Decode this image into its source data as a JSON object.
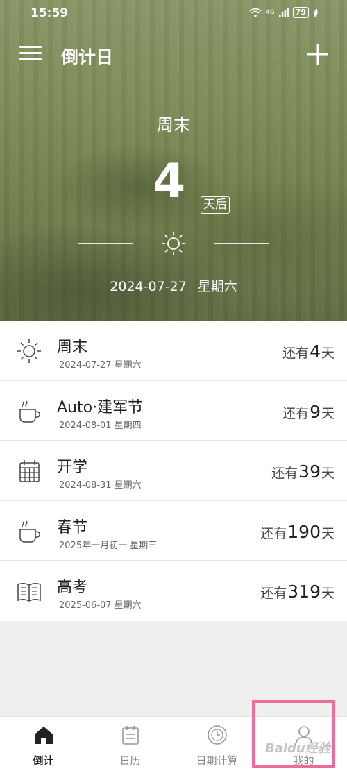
{
  "status": {
    "time": "15:59",
    "network": "4G",
    "battery": "79"
  },
  "header": {
    "title": "倒计日"
  },
  "hero": {
    "name": "周末",
    "count": "4",
    "unit": "天后",
    "date": "2024-07-27 星期六",
    "icon": "sun-icon"
  },
  "events": [
    {
      "name": "周末",
      "date": "2024-07-27 星期六",
      "prefix": "还有",
      "days": "4",
      "suffix": "天",
      "icon": "sun-icon"
    },
    {
      "name": "Auto·建军节",
      "date": "2024-08-01 星期四",
      "prefix": "还有",
      "days": "9",
      "suffix": "天",
      "icon": "coffee-cup-icon"
    },
    {
      "name": "开学",
      "date": "2024-08-31 星期六",
      "prefix": "还有",
      "days": "39",
      "suffix": "天",
      "icon": "calendar-icon"
    },
    {
      "name": "春节",
      "date": "2025年一月初一 星期三",
      "prefix": "还有",
      "days": "190",
      "suffix": "天",
      "icon": "coffee-cup-icon"
    },
    {
      "name": "高考",
      "date": "2025-06-07 星期六",
      "prefix": "还有",
      "days": "319",
      "suffix": "天",
      "icon": "book-icon"
    }
  ],
  "tabs": [
    {
      "label": "倒计",
      "icon": "home-icon",
      "active": true
    },
    {
      "label": "日历",
      "icon": "calendar-icon",
      "active": false
    },
    {
      "label": "日期计算",
      "icon": "clock-icon",
      "active": false
    },
    {
      "label": "我的",
      "icon": "person-icon",
      "active": false
    }
  ],
  "watermark": "Baidu经验",
  "colors": {
    "accent": "#222222",
    "highlight": "#f06a9a"
  }
}
